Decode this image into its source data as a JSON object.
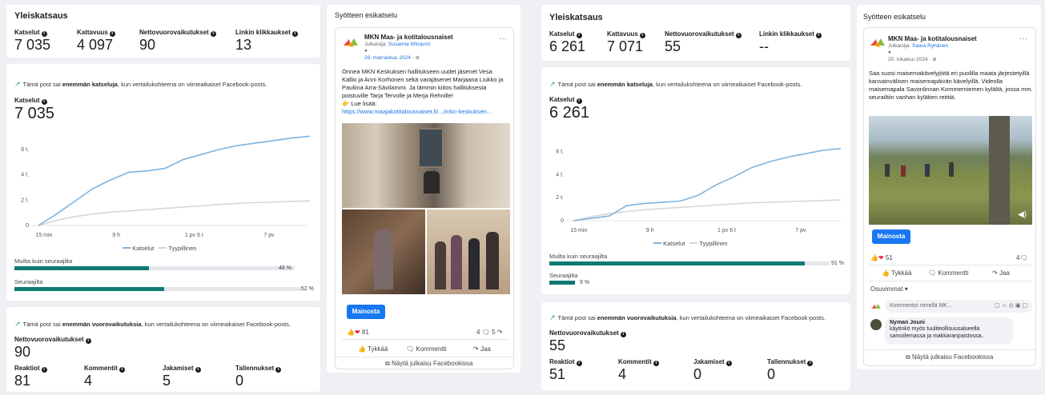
{
  "left": {
    "overview": {
      "title": "Yleiskatsaus",
      "metrics": [
        {
          "label": "Katselut",
          "value": "7 035"
        },
        {
          "label": "Kattavuus",
          "value": "4 097"
        },
        {
          "label": "Nettovuorovaikutukset",
          "value": "90"
        },
        {
          "label": "Linkin klikkaukset",
          "value": "13"
        }
      ]
    },
    "views": {
      "trend_pre": "Tämä post sai",
      "trend_bold": "enemmän katseluja",
      "trend_post": ", kun vertailukohteena on viimeaikaiset Facebook-posts.",
      "label": "Katselut",
      "value": "7 035",
      "legend_series": "Katselut",
      "legend_typical": "Tyypillinen",
      "followers_non_label": "Muilta kuin seuraajilta",
      "followers_non_pct": 48,
      "followers_non_text": "48 %",
      "followers_label": "Seuraajilta",
      "followers_pct": 52,
      "followers_text": "52 %"
    },
    "interactions": {
      "trend_pre": "Tämä post sai",
      "trend_bold": "enemmän vuorovaikutuksia",
      "trend_post": ", kun vertailukohteena on viimeaikaiset Facebook-posts.",
      "net_label": "Nettovuorovaikutukset",
      "net_value": "90",
      "items": [
        {
          "label": "Reaktiot",
          "value": "81"
        },
        {
          "label": "Kommentit",
          "value": "4"
        },
        {
          "label": "Jakamiset",
          "value": "5"
        },
        {
          "label": "Tallennukset",
          "value": "0"
        }
      ]
    },
    "preview": {
      "section_title": "Syötteen esikatselu",
      "page_name": "MKN Maa- ja kotitalousnaiset",
      "published_by_prefix": "Julkaisija:",
      "published_by": "Susanna Winqvist",
      "date": "28. marraskuu 2024",
      "text": "Onnea MKN Keskuksen hallitukseen uudet jäsenet Vesa Kallio ja Anni Korhonen sekä varajäsenet Marjaana Liukko ja Pauliina Arra-Sävilammi. Ja lämmin kiitos hallituksesta poistuville Tarja Tervolle ja Merja Rehnille!",
      "more": "Lue lisää:",
      "link": "https://www.maajakotitalousnaiset.fi/.../mkn-keskuksen...",
      "promote": "Mainosta",
      "reactions": "81",
      "comments_count": "4",
      "shares_count": "5",
      "like": "Tykkää",
      "comment": "Kommentti",
      "share": "Jaa",
      "view_on_fb": "Näytä julkaisu Facebookissa"
    },
    "chart_data": {
      "type": "line",
      "x": [
        "15 min",
        "9 h",
        "1 pv 6 t",
        "7 pv"
      ],
      "yticks": [
        "0",
        "2 t.",
        "4 t.",
        "6 t."
      ],
      "ylim": [
        0,
        7000
      ],
      "series": [
        {
          "name": "Katselut",
          "color": "#7fb3df",
          "values": [
            0,
            900,
            1900,
            2900,
            3600,
            4200,
            4300,
            4500,
            5200,
            5600,
            6000,
            6300,
            6500,
            6700,
            6900,
            7035
          ]
        },
        {
          "name": "Tyypillinen",
          "color": "#d6d6d6",
          "values": [
            0,
            400,
            700,
            900,
            1050,
            1150,
            1250,
            1350,
            1450,
            1550,
            1650,
            1750,
            1800,
            1850,
            1900,
            1950
          ]
        }
      ]
    }
  },
  "right": {
    "overview": {
      "title": "Yleiskatsaus",
      "metrics": [
        {
          "label": "Katselut",
          "value": "6 261"
        },
        {
          "label": "Kattavuus",
          "value": "7 071"
        },
        {
          "label": "Nettovuorovaikutukset",
          "value": "55"
        },
        {
          "label": "Linkin klikkaukset",
          "value": "--"
        }
      ]
    },
    "views": {
      "trend_pre": "Tämä post sai",
      "trend_bold": "enemmän katseluja",
      "trend_post": ", kun vertailukohteena on viimeaikaiset Facebook-posts.",
      "label": "Katselut",
      "value": "6 261",
      "legend_series": "Katselut",
      "legend_typical": "Tyypillinen",
      "followers_non_label": "Muilta kuin seuraajilta",
      "followers_non_pct": 91,
      "followers_non_text": "91 %",
      "followers_label": "Seuraajilta",
      "followers_pct": 9,
      "followers_text": "9 %"
    },
    "interactions": {
      "trend_pre": "Tämä post sai",
      "trend_bold": "enemmän vuorovaikutuksia",
      "trend_post": ", kun vertailukohteena on viimeaikaiset Facebook-posts.",
      "net_label": "Nettovuorovaikutukset",
      "net_value": "55",
      "items": [
        {
          "label": "Reaktiot",
          "value": "51"
        },
        {
          "label": "Kommentit",
          "value": "4"
        },
        {
          "label": "Jakamiset",
          "value": "0"
        },
        {
          "label": "Tallennukset",
          "value": "0"
        }
      ]
    },
    "preview": {
      "section_title": "Syötteen esikatselu",
      "page_name": "MKN Maa- ja kotitalousnaiset",
      "published_by_prefix": "Julkaisija:",
      "published_by": "Saara Ryhänen",
      "date": "20. lokakuu 2024",
      "text": "Saa suosi maisemakävelyjöitä eri puolilla maata järjestetyillä kansainvälisen maisemapäivän kävelyillä. Videolla maisemapala Savonlinnan Kommerniemen kylältä, jossa mm. seurailtiin vanhan kylätien reittiä.",
      "promote": "Mainosta",
      "reactions": "51",
      "comments_count": "4",
      "like": "Tykkää",
      "comment": "Kommentti",
      "share": "Jaa",
      "relevant": "Osuvimmat",
      "comment_placeholder": "Kommentoi nimellä MK...",
      "commenter": "Nyman Jouni",
      "comment_text": "käytinkö myös tuuliteollisuusalueella samoilemassa ja makkaranpaistossa..",
      "view_on_fb": "Näytä julkaisu Facebookissa"
    },
    "chart_data": {
      "type": "line",
      "x": [
        "15 min",
        "9 h",
        "1 pv 6 t",
        "7 pv"
      ],
      "yticks": [
        "0",
        "2 t.",
        "4 t.",
        "6 t."
      ],
      "ylim": [
        0,
        7000
      ],
      "series": [
        {
          "name": "Katselut",
          "color": "#7fb3df",
          "values": [
            0,
            200,
            400,
            1300,
            1500,
            1600,
            1700,
            2200,
            3100,
            3800,
            4600,
            5100,
            5500,
            5800,
            6100,
            6261
          ]
        },
        {
          "name": "Tyypillinen",
          "color": "#d6d6d6",
          "values": [
            0,
            350,
            600,
            800,
            950,
            1050,
            1150,
            1250,
            1350,
            1450,
            1550,
            1600,
            1650,
            1700,
            1750,
            1800
          ]
        }
      ]
    }
  }
}
